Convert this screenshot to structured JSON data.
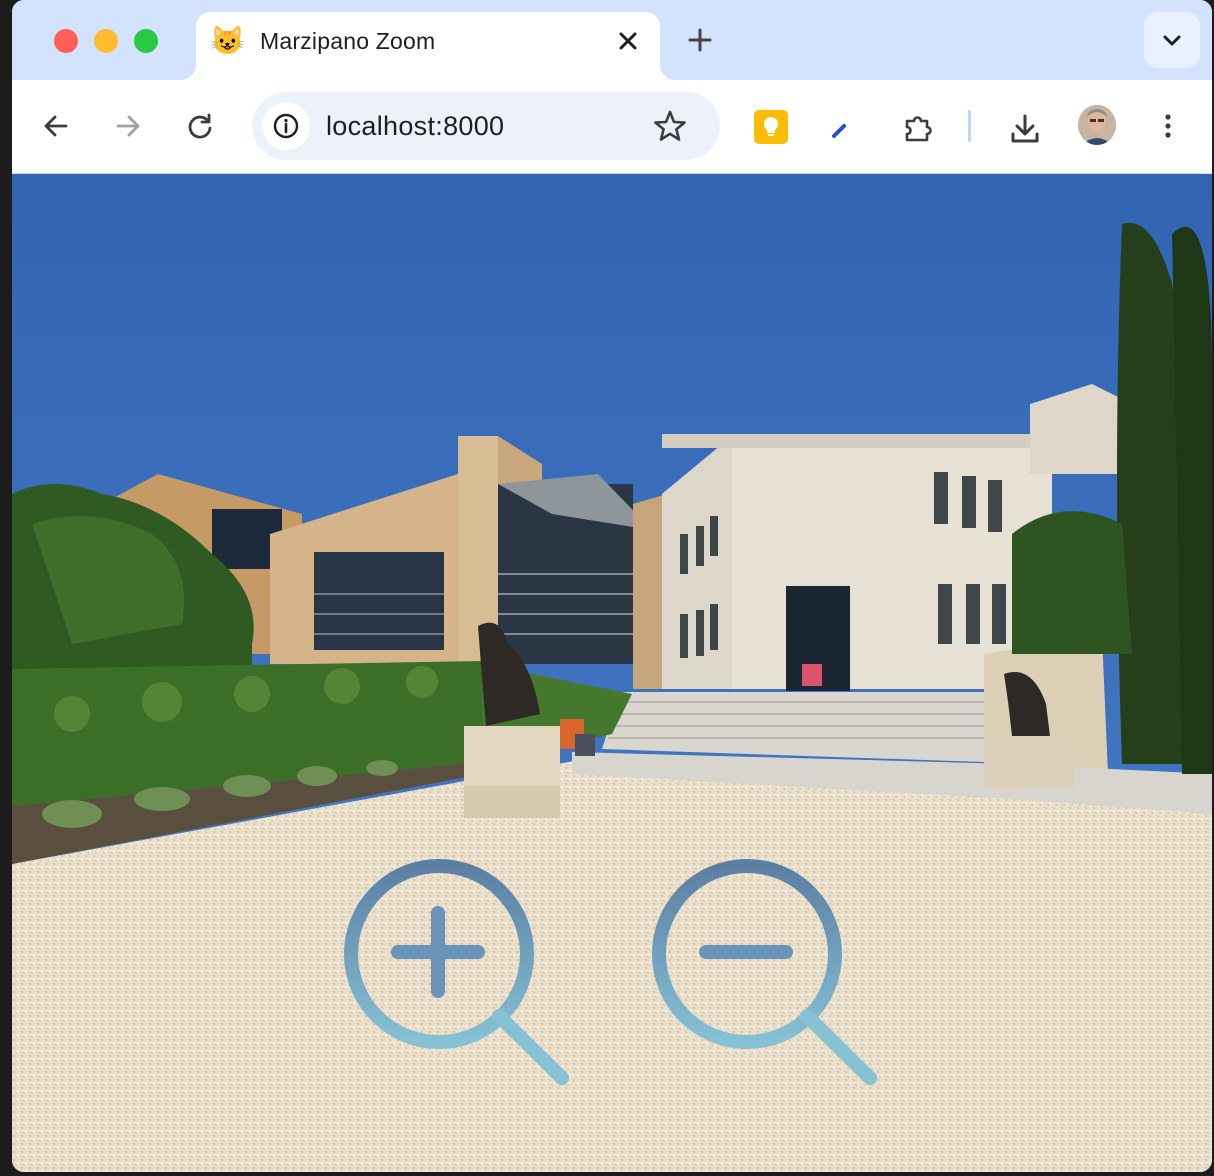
{
  "browser": {
    "tab": {
      "title": "Marzipano Zoom",
      "favicon": "😺"
    },
    "address": {
      "url": "localhost:8000"
    },
    "icons": {
      "close": "close-icon",
      "new_tab": "plus-icon",
      "tab_search": "chevron-down-icon",
      "back": "arrow-left-icon",
      "forward": "arrow-right-icon",
      "reload": "reload-icon",
      "site_info": "info-icon",
      "bookmark": "star-icon",
      "extension_keep": "lightbulb-icon",
      "extension_pen": "pen-icon",
      "extensions": "puzzle-icon",
      "downloads": "download-icon",
      "profile": "avatar",
      "menu": "kebab-menu-icon"
    }
  },
  "viewer": {
    "scene": "Panorama of a museum courtyard with gravel plaza, hedges, sculptures and stone building",
    "controls": {
      "zoom_in": {
        "icon": "zoom-in-icon"
      },
      "zoom_out": {
        "icon": "zoom-out-icon"
      }
    },
    "colors": {
      "control_top": "#5b7fa3",
      "control_bottom": "#86c1d4",
      "sky": "#3c6db4",
      "gravel": "#e7dcc7"
    }
  }
}
